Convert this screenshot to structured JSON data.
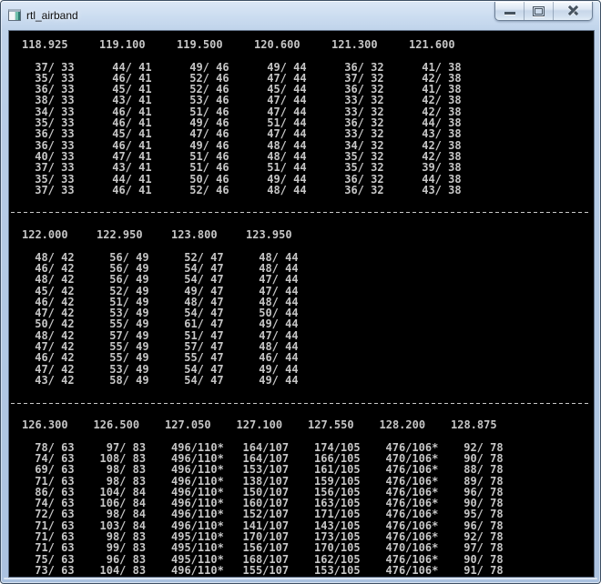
{
  "window": {
    "title": "rtl_airband",
    "icons": {
      "app": "console-window-icon",
      "minimize": "minimize-bar-icon",
      "maximize": "maximize-square-icon",
      "close": "close-x-icon"
    }
  },
  "colors": {
    "terminal_bg": "#000000",
    "terminal_fg": "#c6c6c6",
    "titlebar_top": "#dce8f6",
    "titlebar_bottom": "#abc2e0"
  },
  "terminal": {
    "sections": [
      {
        "frequencies": [
          "118.925",
          "119.100",
          "119.500",
          "120.600",
          "121.300",
          "121.600"
        ],
        "rows": [
          [
            "37/ 33",
            "44/ 41",
            "49/ 46",
            "49/ 44",
            "36/ 32",
            "41/ 38"
          ],
          [
            "35/ 33",
            "46/ 41",
            "52/ 46",
            "47/ 44",
            "37/ 32",
            "42/ 38"
          ],
          [
            "36/ 33",
            "45/ 41",
            "52/ 46",
            "45/ 44",
            "36/ 32",
            "41/ 38"
          ],
          [
            "38/ 33",
            "43/ 41",
            "53/ 46",
            "47/ 44",
            "33/ 32",
            "42/ 38"
          ],
          [
            "34/ 33",
            "46/ 41",
            "51/ 46",
            "47/ 44",
            "33/ 32",
            "42/ 38"
          ],
          [
            "35/ 33",
            "46/ 41",
            "49/ 46",
            "51/ 44",
            "36/ 32",
            "44/ 38"
          ],
          [
            "36/ 33",
            "45/ 41",
            "47/ 46",
            "47/ 44",
            "33/ 32",
            "43/ 38"
          ],
          [
            "36/ 33",
            "46/ 41",
            "49/ 46",
            "48/ 44",
            "34/ 32",
            "42/ 38"
          ],
          [
            "40/ 33",
            "47/ 41",
            "51/ 46",
            "48/ 44",
            "35/ 32",
            "42/ 38"
          ],
          [
            "37/ 33",
            "43/ 41",
            "51/ 46",
            "51/ 44",
            "35/ 32",
            "39/ 38"
          ],
          [
            "35/ 33",
            "44/ 41",
            "50/ 46",
            "49/ 44",
            "36/ 32",
            "44/ 38"
          ],
          [
            "37/ 33",
            "46/ 41",
            "52/ 46",
            "48/ 44",
            "36/ 32",
            "43/ 38"
          ]
        ]
      },
      {
        "frequencies": [
          "122.000",
          "122.950",
          "123.800",
          "123.950"
        ],
        "rows": [
          [
            "48/ 42",
            "56/ 49",
            "52/ 47",
            "48/ 44"
          ],
          [
            "46/ 42",
            "56/ 49",
            "54/ 47",
            "48/ 44"
          ],
          [
            "48/ 42",
            "56/ 49",
            "54/ 47",
            "47/ 44"
          ],
          [
            "45/ 42",
            "52/ 49",
            "49/ 47",
            "47/ 44"
          ],
          [
            "46/ 42",
            "51/ 49",
            "48/ 47",
            "48/ 44"
          ],
          [
            "47/ 42",
            "53/ 49",
            "54/ 47",
            "50/ 44"
          ],
          [
            "50/ 42",
            "55/ 49",
            "61/ 47",
            "49/ 44"
          ],
          [
            "48/ 42",
            "57/ 49",
            "51/ 47",
            "47/ 44"
          ],
          [
            "47/ 42",
            "55/ 49",
            "57/ 47",
            "48/ 44"
          ],
          [
            "46/ 42",
            "55/ 49",
            "55/ 47",
            "46/ 44"
          ],
          [
            "47/ 42",
            "53/ 49",
            "54/ 47",
            "49/ 44"
          ],
          [
            "43/ 42",
            "58/ 49",
            "54/ 47",
            "49/ 44"
          ]
        ]
      },
      {
        "frequencies": [
          "126.300",
          "126.500",
          "127.050",
          "127.100",
          "127.550",
          "128.200",
          "128.875"
        ],
        "rows": [
          [
            "78/ 63",
            "97/ 83",
            "496/110*",
            "164/107",
            "174/105",
            "476/106*",
            "92/ 78"
          ],
          [
            "74/ 63",
            "108/ 83",
            "496/110*",
            "164/107",
            "166/105",
            "470/106*",
            "90/ 78"
          ],
          [
            "69/ 63",
            "98/ 83",
            "496/110*",
            "153/107",
            "161/105",
            "476/106*",
            "88/ 78"
          ],
          [
            "71/ 63",
            "98/ 83",
            "496/110*",
            "138/107",
            "159/105",
            "476/106*",
            "89/ 78"
          ],
          [
            "86/ 63",
            "104/ 84",
            "496/110*",
            "150/107",
            "156/105",
            "476/106*",
            "96/ 78"
          ],
          [
            "74/ 63",
            "106/ 84",
            "496/110*",
            "160/107",
            "163/105",
            "476/106*",
            "90/ 78"
          ],
          [
            "72/ 63",
            "98/ 84",
            "496/110*",
            "152/107",
            "171/105",
            "476/106*",
            "95/ 78"
          ],
          [
            "71/ 63",
            "103/ 84",
            "496/110*",
            "141/107",
            "143/105",
            "476/106*",
            "96/ 78"
          ],
          [
            "71/ 63",
            "98/ 83",
            "495/110*",
            "170/107",
            "173/105",
            "476/106*",
            "92/ 78"
          ],
          [
            "71/ 63",
            "99/ 83",
            "495/110*",
            "156/107",
            "170/105",
            "470/106*",
            "97/ 78"
          ],
          [
            "75/ 63",
            "96/ 83",
            "495/110*",
            "168/107",
            "162/105",
            "476/106*",
            "90/ 78"
          ],
          [
            "73/ 63",
            "104/ 83",
            "496/110*",
            "155/107",
            "153/105",
            "476/106*",
            "91/ 78"
          ]
        ]
      }
    ]
  }
}
